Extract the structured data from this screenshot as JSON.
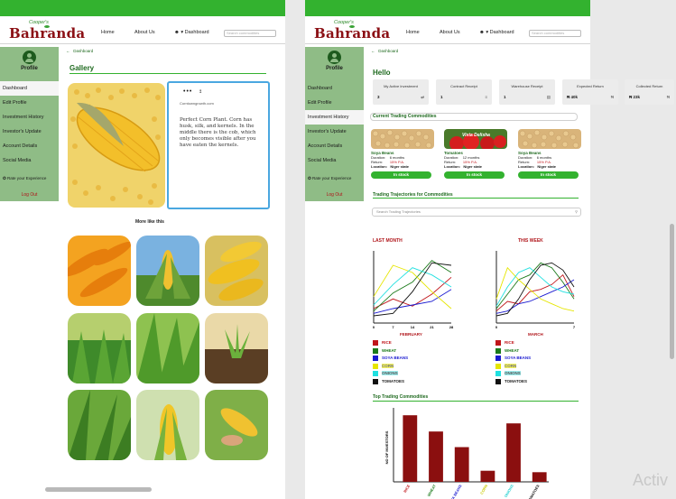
{
  "brand": {
    "sub": "Cooper's",
    "name": "Bahranda"
  },
  "nav": {
    "home": "Home",
    "about": "About Us",
    "dashboard": "Dashboard",
    "search_placeholder": "Search commodities"
  },
  "sidebar": {
    "profile_label": "Profile",
    "items": [
      "Dashboard",
      "Edit Profile",
      "Investment History",
      "Investor's Update",
      "Account Details",
      "Social Media"
    ],
    "rate": "Rate your Experience",
    "logout": "Log Out"
  },
  "screen1": {
    "breadcrumb": "Dashboard",
    "title": "Gallery",
    "card": {
      "dots": "•••",
      "source": "Corntowngrowth.com",
      "description": "Perfect Corn Plant. Corn has husk, silk, and kernels. In the middle there is the cob, which only becomes visible after you have eaten the kernels."
    },
    "more_like": "More like this"
  },
  "screen2": {
    "breadcrumb": "Dashboard",
    "hello": "Hello",
    "stats": [
      {
        "label": "My Active Investment",
        "value": "3",
        "icon": "⇄"
      },
      {
        "label": "Contract Receipt",
        "value": "1",
        "icon": "≡"
      },
      {
        "label": "Warehouse Receipt",
        "value": "1",
        "icon": "▤"
      },
      {
        "label": "Expected Return",
        "value": "₦ 40k",
        "icon": "₦"
      },
      {
        "label": "Collected Return",
        "value": "₦ 23k",
        "icon": "₦"
      }
    ],
    "current_title": "Current Trading Commodities",
    "commodities": [
      {
        "name": "Soya Beans",
        "duration_label": "Duration:",
        "duration": "6 months",
        "return_label": "Return:",
        "return": "15% P.A.",
        "location_label": "Location:",
        "location": "Niger state",
        "btn": "In stock"
      },
      {
        "name": "Tomatoes",
        "duration_label": "Duration:",
        "duration": "12 months",
        "return_label": "Return:",
        "return": "15% P.A.",
        "location_label": "Location:",
        "location": "Niger state",
        "btn": "In stock",
        "tag": "Vista Delisha"
      },
      {
        "name": "Soya Beans",
        "duration_label": "Duration:",
        "duration": "6 months",
        "return_label": "Return:",
        "return": "15% P.A.",
        "location_label": "Location:",
        "location": "Niger state",
        "btn": "In stock"
      }
    ],
    "traj_title": "Trading Trajectories for Commodities",
    "traj_search": "Search Trading Trajectories",
    "month_labels": {
      "last": "LAST MONTH",
      "this": "THIS WEEK",
      "feb": "FEBRUARY",
      "march": "MARCH"
    },
    "legend": [
      {
        "name": "RICE",
        "color": "#c0151a"
      },
      {
        "name": "WHEAT",
        "color": "#1b7a1b"
      },
      {
        "name": "SOYA BEANS",
        "color": "#1a1ad0"
      },
      {
        "name": "CORN",
        "color": "#e6e600"
      },
      {
        "name": "ONIONS",
        "color": "#20e0e0"
      },
      {
        "name": "TOMATOES",
        "color": "#111111"
      }
    ],
    "top_title": "Top Trading Commodities"
  },
  "chart_data": [
    {
      "type": "line",
      "title": "LAST MONTH",
      "xlabel": "FEBRUARY",
      "x": [
        0,
        7,
        14,
        21,
        28
      ],
      "xlim": [
        0,
        28
      ],
      "series": [
        {
          "name": "RICE",
          "values": [
            1.2,
            2.0,
            1.4,
            2.4,
            3.8
          ]
        },
        {
          "name": "WHEAT",
          "values": [
            1.0,
            2.5,
            3.4,
            5.2,
            4.2
          ]
        },
        {
          "name": "SOYA BEANS",
          "values": [
            0.8,
            1.2,
            1.5,
            1.8,
            2.8
          ]
        },
        {
          "name": "CORN",
          "values": [
            2.2,
            4.8,
            4.2,
            2.6,
            1.2
          ]
        },
        {
          "name": "ONIONS",
          "values": [
            1.5,
            3.2,
            4.6,
            4.0,
            3.0
          ]
        },
        {
          "name": "TOMATOES",
          "values": [
            0.6,
            0.8,
            2.6,
            5.0,
            4.8
          ]
        }
      ],
      "ylim": [
        0,
        6
      ]
    },
    {
      "type": "line",
      "title": "THIS WEEK",
      "xlabel": "MARCH",
      "x": [
        0,
        1,
        2,
        3,
        4,
        5,
        6,
        7
      ],
      "xlim": [
        0,
        7
      ],
      "series": [
        {
          "name": "RICE",
          "values": [
            1.0,
            1.8,
            1.6,
            2.6,
            2.8,
            3.2,
            4.0,
            2.2
          ]
        },
        {
          "name": "WHEAT",
          "values": [
            1.2,
            2.4,
            3.6,
            4.0,
            5.0,
            4.6,
            3.4,
            2.0
          ]
        },
        {
          "name": "SOYA BEANS",
          "values": [
            0.8,
            1.0,
            1.6,
            1.8,
            2.2,
            2.6,
            3.0,
            3.6
          ]
        },
        {
          "name": "CORN",
          "values": [
            2.0,
            4.6,
            3.6,
            2.8,
            2.0,
            1.6,
            1.2,
            1.0
          ]
        },
        {
          "name": "ONIONS",
          "values": [
            1.4,
            3.0,
            4.2,
            4.6,
            3.8,
            3.0,
            2.6,
            2.4
          ]
        },
        {
          "name": "TOMATOES",
          "values": [
            0.6,
            0.8,
            2.0,
            3.6,
            4.8,
            5.0,
            4.4,
            3.0
          ]
        }
      ],
      "ylim": [
        0,
        6
      ]
    },
    {
      "type": "bar",
      "title": "Top Trading Commodities",
      "ylabel": "NO OF INVESTORS",
      "categories": [
        "RICE",
        "WHEAT",
        "SOYA BEANS",
        "CORN",
        "ONIONS",
        "TOMATOES"
      ],
      "values": [
        90,
        68,
        47,
        15,
        79,
        13
      ],
      "ylim": [
        0,
        100
      ],
      "colors": [
        "#c0151a",
        "#1b7a1b",
        "#1a1ad0",
        "#c9c900",
        "#20d0d0",
        "#111111"
      ]
    }
  ]
}
